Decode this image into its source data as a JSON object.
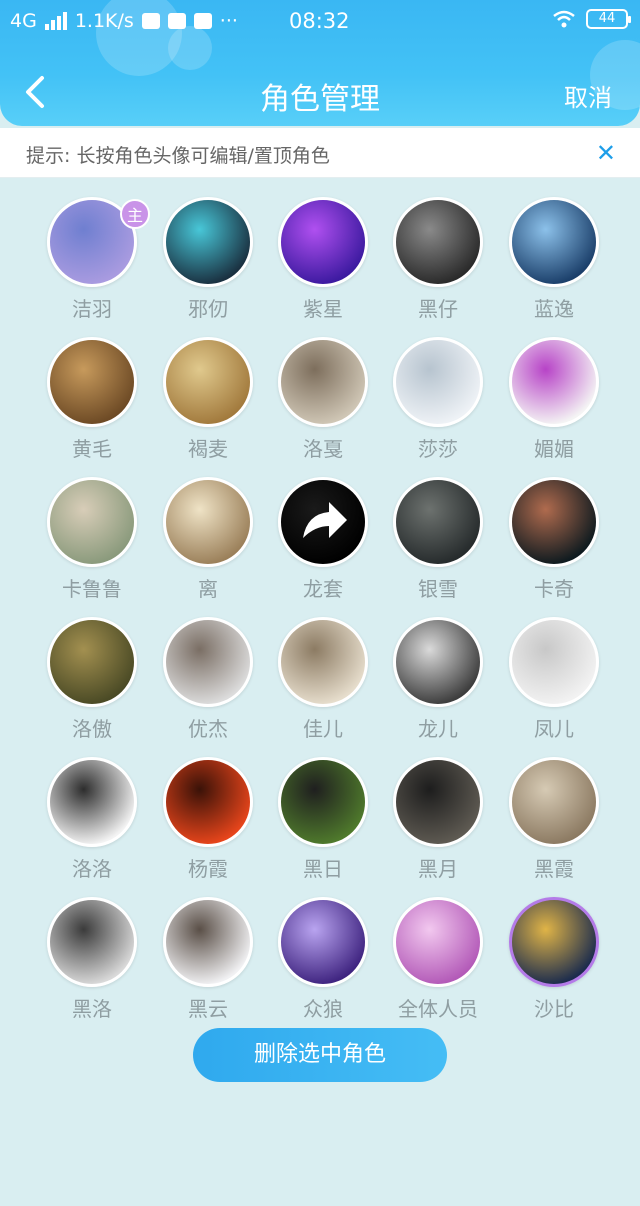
{
  "status_bar": {
    "network": "4G",
    "speed": "1.1K/s",
    "dots": "···",
    "time": "08:32",
    "battery": "44"
  },
  "nav": {
    "title": "角色管理",
    "cancel": "取消"
  },
  "tip": {
    "text": "提示: 长按角色头像可编辑/置顶角色",
    "close": "✕"
  },
  "owner_badge": "主",
  "roles": [
    {
      "name": "洁羽",
      "colors": [
        "#a99be0",
        "#6f7fd0"
      ]
    },
    {
      "name": "邪仞",
      "colors": [
        "#1a3040",
        "#48c7d8"
      ]
    },
    {
      "name": "紫星",
      "colors": [
        "#3c1aa0",
        "#b050f0"
      ]
    },
    {
      "name": "黑仔",
      "colors": [
        "#2a2a2a",
        "#8a8a8a"
      ]
    },
    {
      "name": "蓝逸",
      "colors": [
        "#1b3f6a",
        "#8cc1ea"
      ]
    },
    {
      "name": "黄毛",
      "colors": [
        "#6d4a25",
        "#c79a5c"
      ]
    },
    {
      "name": "褐麦",
      "colors": [
        "#a27a3d",
        "#e0c98d"
      ]
    },
    {
      "name": "洛戛",
      "colors": [
        "#cfc6b5",
        "#7d6e5c"
      ]
    },
    {
      "name": "莎莎",
      "colors": [
        "#eef2f6",
        "#b7c4cf"
      ]
    },
    {
      "name": "媚媚",
      "colors": [
        "#f4f4f4",
        "#b743c7"
      ]
    },
    {
      "name": "卡鲁鲁",
      "colors": [
        "#8a9a7c",
        "#d8cdb8"
      ]
    },
    {
      "name": "离",
      "colors": [
        "#9b805a",
        "#efe3c6"
      ]
    },
    {
      "name": "龙套",
      "colors": [
        "#000000",
        "#1a1a1a"
      ]
    },
    {
      "name": "银雪",
      "colors": [
        "#262b2c",
        "#6d726f"
      ]
    },
    {
      "name": "卡奇",
      "colors": [
        "#0e1a1f",
        "#b06b4e"
      ]
    },
    {
      "name": "洛傲",
      "colors": [
        "#4a4a25",
        "#a39050"
      ]
    },
    {
      "name": "优杰",
      "colors": [
        "#dcdcdc",
        "#7a6e64"
      ]
    },
    {
      "name": "佳儿",
      "colors": [
        "#e6ddcc",
        "#8c7b63"
      ]
    },
    {
      "name": "龙儿",
      "colors": [
        "#3d3d3d",
        "#dadada"
      ]
    },
    {
      "name": "凤儿",
      "colors": [
        "#f2f2f2",
        "#c8c8c8"
      ]
    },
    {
      "name": "洛洛",
      "colors": [
        "#f3f3f3",
        "#2d2d2d"
      ]
    },
    {
      "name": "杨霞",
      "colors": [
        "#e7451b",
        "#3a1208"
      ]
    },
    {
      "name": "黑日",
      "colors": [
        "#4f7a2c",
        "#1f1f1f"
      ]
    },
    {
      "name": "黑月",
      "colors": [
        "#5e5a52",
        "#1d1d1d"
      ]
    },
    {
      "name": "黑霞",
      "colors": [
        "#8c7a62",
        "#d6cab4"
      ]
    },
    {
      "name": "黑洛",
      "colors": [
        "#d9d9d9",
        "#3b3b3b"
      ]
    },
    {
      "name": "黑云",
      "colors": [
        "#f1f1f3",
        "#5a4f47"
      ]
    },
    {
      "name": "众狼",
      "colors": [
        "#3f2480",
        "#b9a4f0"
      ]
    },
    {
      "name": "全体人员",
      "colors": [
        "#b35ab8",
        "#f2c8ef"
      ]
    },
    {
      "name": "沙比",
      "colors": [
        "#1c2c4d",
        "#e0b447"
      ]
    }
  ],
  "delete_button": "删除选中角色"
}
